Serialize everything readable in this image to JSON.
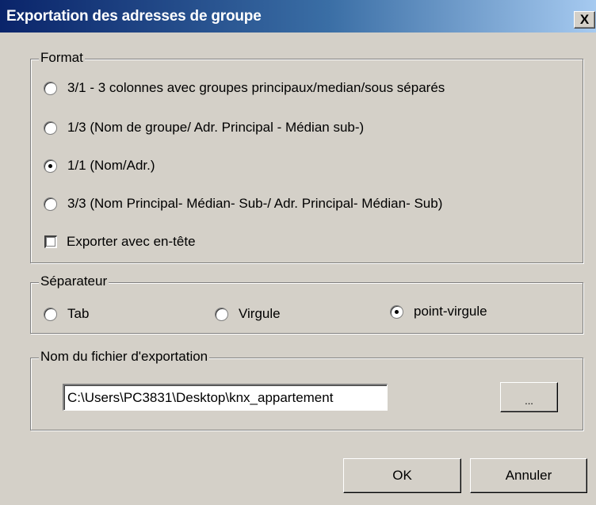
{
  "window": {
    "title": "Exportation des adresses de groupe",
    "close_label": "X"
  },
  "format": {
    "legend": "Format",
    "options": [
      {
        "label": "3/1 - 3 colonnes avec groupes principaux/median/sous séparés",
        "selected": false
      },
      {
        "label": "1/3 (Nom de groupe/ Adr. Principal - Médian sub-)",
        "selected": false
      },
      {
        "label": "1/1 (Nom/Adr.)",
        "selected": true
      },
      {
        "label": "3/3 (Nom Principal- Médian- Sub-/ Adr. Principal- Médian- Sub)",
        "selected": false
      }
    ],
    "header_checkbox": {
      "label": "Exporter avec en-tête",
      "checked": false
    }
  },
  "separator": {
    "legend": "Séparateur",
    "options": [
      {
        "label": "Tab",
        "selected": false
      },
      {
        "label": "Virgule",
        "selected": false
      },
      {
        "label": "point-virgule",
        "selected": true
      }
    ]
  },
  "file": {
    "legend": "Nom du fichier d'exportation",
    "path_value": "C:\\Users\\PC3831\\Desktop\\knx_appartement",
    "browse_label": "..."
  },
  "buttons": {
    "ok": "OK",
    "cancel": "Annuler"
  }
}
